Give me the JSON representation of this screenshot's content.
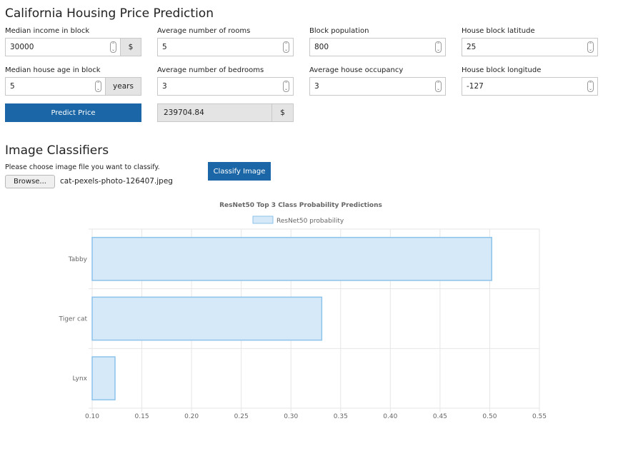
{
  "housing": {
    "title": "California Housing Price Prediction",
    "fields": {
      "income": {
        "label": "Median income in block",
        "value": "30000",
        "unit": "$"
      },
      "rooms": {
        "label": "Average number of rooms",
        "value": "5"
      },
      "population": {
        "label": "Block population",
        "value": "800"
      },
      "latitude": {
        "label": "House block latitude",
        "value": "25"
      },
      "age": {
        "label": "Median house age in block",
        "value": "5",
        "unit": "years"
      },
      "bedrooms": {
        "label": "Average number of bedrooms",
        "value": "3"
      },
      "occupancy": {
        "label": "Average house occupancy",
        "value": "3"
      },
      "longitude": {
        "label": "House block longitude",
        "value": "-127"
      }
    },
    "predict_label": "Predict Price",
    "result_value": "239704.84",
    "result_unit": "$"
  },
  "classifier": {
    "title": "Image Classifiers",
    "prompt": "Please choose image file you want to classify.",
    "browse_label": "Browse...",
    "file_name": "cat-pexels-photo-126407.jpeg",
    "classify_label": "Classify Image"
  },
  "colors": {
    "accent": "#1a66a6",
    "bar_fill": "#d6e9f8",
    "bar_stroke": "#8cc3ea"
  },
  "chart_data": {
    "type": "bar",
    "orientation": "horizontal",
    "title": "ResNet50 Top 3 Class Probability Predictions",
    "categories": [
      "Tabby",
      "Tiger cat",
      "Lynx"
    ],
    "series": [
      {
        "name": "ResNet50 probability",
        "values": [
          0.502,
          0.331,
          0.123
        ]
      }
    ],
    "xlim": [
      0.1,
      0.55
    ],
    "xticks": [
      "0.10",
      "0.15",
      "0.20",
      "0.25",
      "0.30",
      "0.35",
      "0.40",
      "0.45",
      "0.50",
      "0.55"
    ],
    "xlabel": "",
    "ylabel": "",
    "grid": true,
    "legend": "top-center"
  }
}
